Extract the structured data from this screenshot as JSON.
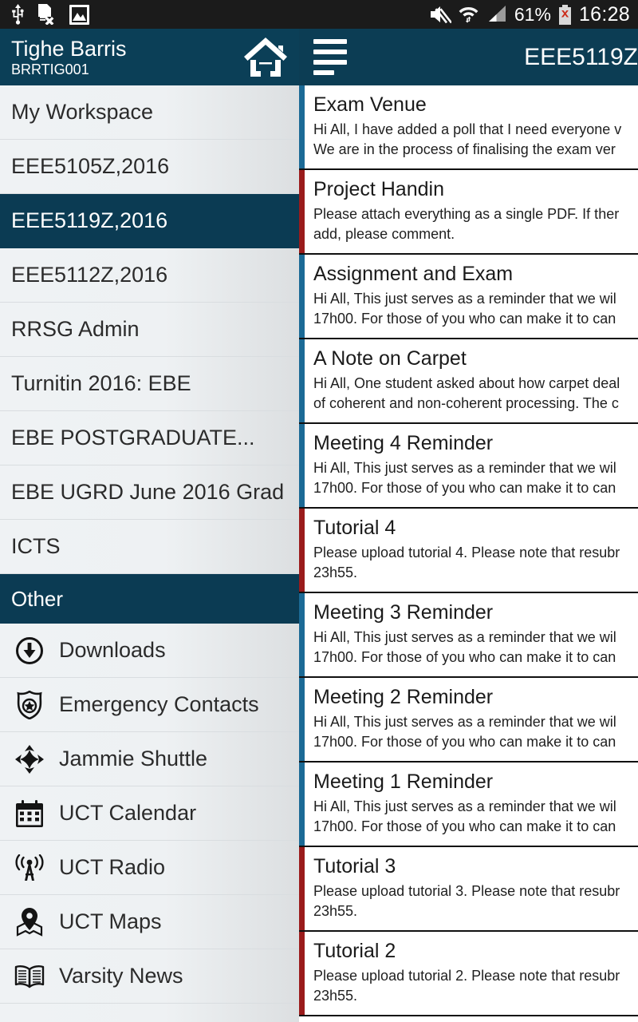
{
  "statusbar": {
    "icons_left": [
      "usb-icon",
      "document-remove-icon",
      "picture-icon"
    ],
    "icons_right": [
      "mute-icon",
      "wifi-icon",
      "signal-icon"
    ],
    "battery_percent": "61%",
    "battery_icon": "battery-error-icon",
    "time": "16:28"
  },
  "appbar": {
    "user_name": "Tighe Barris",
    "user_id": "BRRTIG001",
    "home_icon": "home-icon",
    "menu_icon": "hamburger-menu-icon",
    "site_title": "EEE5119Z"
  },
  "sidebar": {
    "sites": [
      {
        "label": "My Workspace",
        "selected": false
      },
      {
        "label": "EEE5105Z,2016",
        "selected": false
      },
      {
        "label": "EEE5119Z,2016",
        "selected": true
      },
      {
        "label": "EEE5112Z,2016",
        "selected": false
      },
      {
        "label": "RRSG Admin",
        "selected": false
      },
      {
        "label": "Turnitin 2016: EBE",
        "selected": false
      },
      {
        "label": "EBE POSTGRADUATE...",
        "selected": false
      },
      {
        "label": "EBE UGRD June 2016 Grad",
        "selected": false
      },
      {
        "label": "ICTS",
        "selected": false
      }
    ],
    "section_title": "Other",
    "tools": [
      {
        "label": "Downloads",
        "icon": "download-circle-icon"
      },
      {
        "label": "Emergency Contacts",
        "icon": "shield-star-icon"
      },
      {
        "label": "Jammie Shuttle",
        "icon": "four-way-arrows-icon"
      },
      {
        "label": "UCT Calendar",
        "icon": "calendar-icon"
      },
      {
        "label": "UCT Radio",
        "icon": "radio-tower-icon"
      },
      {
        "label": "UCT Maps",
        "icon": "map-pin-icon"
      },
      {
        "label": "Varsity News",
        "icon": "open-book-icon"
      }
    ]
  },
  "colors": {
    "appbar_navy": "#0b3f57",
    "selected_navy": "#0b3b53",
    "accent_blue": "#1b6a96",
    "accent_red": "#9a1b1b",
    "statusbar_black": "#1b1b1b"
  },
  "announcements": [
    {
      "title": "Exam Venue",
      "body": "Hi All, I have added a poll that I need everyone v\nWe are in the process of finalising the exam ver",
      "accent": "#1b6a96"
    },
    {
      "title": "Project Handin",
      "body": "Please attach everything as a single PDF. If ther\nadd, please comment.",
      "accent": "#9a1b1b"
    },
    {
      "title": "Assignment and Exam",
      "body": "Hi All, This just serves as a reminder that we wil\n17h00. For those of you who can make it to can",
      "accent": "#1b6a96"
    },
    {
      "title": "A Note on Carpet",
      "body": "Hi All, One student asked about how carpet deal\nof coherent and non-coherent processing. The c",
      "accent": "#1b6a96"
    },
    {
      "title": "Meeting 4 Reminder",
      "body": "Hi All, This just serves as a reminder that we wil\n17h00. For those of you who can make it to can",
      "accent": "#1b6a96"
    },
    {
      "title": "Tutorial 4",
      "body": "Please upload tutorial 4. Please note that resubr\n23h55.",
      "accent": "#9a1b1b"
    },
    {
      "title": "Meeting 3 Reminder",
      "body": "Hi All, This just serves as a reminder that we wil\n17h00. For those of you who can make it to can",
      "accent": "#1b6a96"
    },
    {
      "title": "Meeting 2 Reminder",
      "body": "Hi All, This just serves as a reminder that we wil\n17h00. For those of you who can make it to can",
      "accent": "#1b6a96"
    },
    {
      "title": "Meeting 1 Reminder",
      "body": "Hi All, This just serves as a reminder that we wil\n17h00. For those of you who can make it to can",
      "accent": "#1b6a96"
    },
    {
      "title": "Tutorial 3",
      "body": "Please upload tutorial 3. Please note that resubr\n23h55.",
      "accent": "#9a1b1b"
    },
    {
      "title": "Tutorial 2",
      "body": "Please upload tutorial 2. Please note that resubr\n23h55.",
      "accent": "#9a1b1b"
    }
  ]
}
